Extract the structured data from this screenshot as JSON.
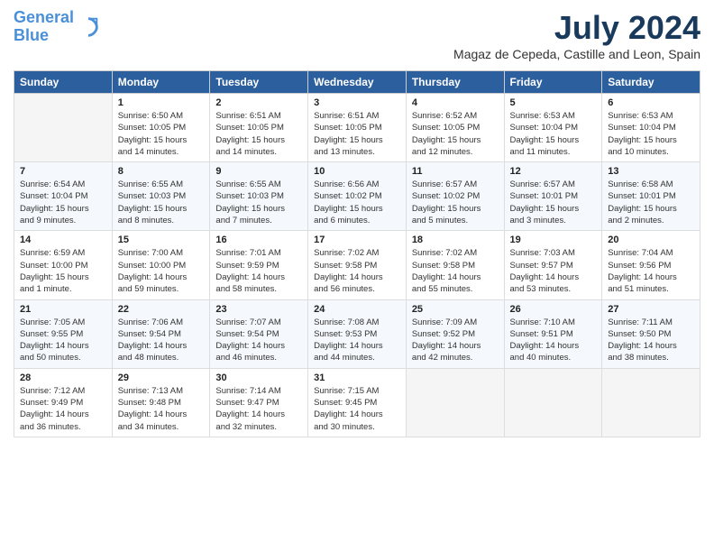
{
  "header": {
    "logo_line1": "General",
    "logo_line2": "Blue",
    "month_title": "July 2024",
    "location": "Magaz de Cepeda, Castille and Leon, Spain"
  },
  "days_of_week": [
    "Sunday",
    "Monday",
    "Tuesday",
    "Wednesday",
    "Thursday",
    "Friday",
    "Saturday"
  ],
  "weeks": [
    [
      {
        "day": "",
        "info": ""
      },
      {
        "day": "1",
        "info": "Sunrise: 6:50 AM\nSunset: 10:05 PM\nDaylight: 15 hours\nand 14 minutes."
      },
      {
        "day": "2",
        "info": "Sunrise: 6:51 AM\nSunset: 10:05 PM\nDaylight: 15 hours\nand 14 minutes."
      },
      {
        "day": "3",
        "info": "Sunrise: 6:51 AM\nSunset: 10:05 PM\nDaylight: 15 hours\nand 13 minutes."
      },
      {
        "day": "4",
        "info": "Sunrise: 6:52 AM\nSunset: 10:05 PM\nDaylight: 15 hours\nand 12 minutes."
      },
      {
        "day": "5",
        "info": "Sunrise: 6:53 AM\nSunset: 10:04 PM\nDaylight: 15 hours\nand 11 minutes."
      },
      {
        "day": "6",
        "info": "Sunrise: 6:53 AM\nSunset: 10:04 PM\nDaylight: 15 hours\nand 10 minutes."
      }
    ],
    [
      {
        "day": "7",
        "info": "Sunrise: 6:54 AM\nSunset: 10:04 PM\nDaylight: 15 hours\nand 9 minutes."
      },
      {
        "day": "8",
        "info": "Sunrise: 6:55 AM\nSunset: 10:03 PM\nDaylight: 15 hours\nand 8 minutes."
      },
      {
        "day": "9",
        "info": "Sunrise: 6:55 AM\nSunset: 10:03 PM\nDaylight: 15 hours\nand 7 minutes."
      },
      {
        "day": "10",
        "info": "Sunrise: 6:56 AM\nSunset: 10:02 PM\nDaylight: 15 hours\nand 6 minutes."
      },
      {
        "day": "11",
        "info": "Sunrise: 6:57 AM\nSunset: 10:02 PM\nDaylight: 15 hours\nand 5 minutes."
      },
      {
        "day": "12",
        "info": "Sunrise: 6:57 AM\nSunset: 10:01 PM\nDaylight: 15 hours\nand 3 minutes."
      },
      {
        "day": "13",
        "info": "Sunrise: 6:58 AM\nSunset: 10:01 PM\nDaylight: 15 hours\nand 2 minutes."
      }
    ],
    [
      {
        "day": "14",
        "info": "Sunrise: 6:59 AM\nSunset: 10:00 PM\nDaylight: 15 hours\nand 1 minute."
      },
      {
        "day": "15",
        "info": "Sunrise: 7:00 AM\nSunset: 10:00 PM\nDaylight: 14 hours\nand 59 minutes."
      },
      {
        "day": "16",
        "info": "Sunrise: 7:01 AM\nSunset: 9:59 PM\nDaylight: 14 hours\nand 58 minutes."
      },
      {
        "day": "17",
        "info": "Sunrise: 7:02 AM\nSunset: 9:58 PM\nDaylight: 14 hours\nand 56 minutes."
      },
      {
        "day": "18",
        "info": "Sunrise: 7:02 AM\nSunset: 9:58 PM\nDaylight: 14 hours\nand 55 minutes."
      },
      {
        "day": "19",
        "info": "Sunrise: 7:03 AM\nSunset: 9:57 PM\nDaylight: 14 hours\nand 53 minutes."
      },
      {
        "day": "20",
        "info": "Sunrise: 7:04 AM\nSunset: 9:56 PM\nDaylight: 14 hours\nand 51 minutes."
      }
    ],
    [
      {
        "day": "21",
        "info": "Sunrise: 7:05 AM\nSunset: 9:55 PM\nDaylight: 14 hours\nand 50 minutes."
      },
      {
        "day": "22",
        "info": "Sunrise: 7:06 AM\nSunset: 9:54 PM\nDaylight: 14 hours\nand 48 minutes."
      },
      {
        "day": "23",
        "info": "Sunrise: 7:07 AM\nSunset: 9:54 PM\nDaylight: 14 hours\nand 46 minutes."
      },
      {
        "day": "24",
        "info": "Sunrise: 7:08 AM\nSunset: 9:53 PM\nDaylight: 14 hours\nand 44 minutes."
      },
      {
        "day": "25",
        "info": "Sunrise: 7:09 AM\nSunset: 9:52 PM\nDaylight: 14 hours\nand 42 minutes."
      },
      {
        "day": "26",
        "info": "Sunrise: 7:10 AM\nSunset: 9:51 PM\nDaylight: 14 hours\nand 40 minutes."
      },
      {
        "day": "27",
        "info": "Sunrise: 7:11 AM\nSunset: 9:50 PM\nDaylight: 14 hours\nand 38 minutes."
      }
    ],
    [
      {
        "day": "28",
        "info": "Sunrise: 7:12 AM\nSunset: 9:49 PM\nDaylight: 14 hours\nand 36 minutes."
      },
      {
        "day": "29",
        "info": "Sunrise: 7:13 AM\nSunset: 9:48 PM\nDaylight: 14 hours\nand 34 minutes."
      },
      {
        "day": "30",
        "info": "Sunrise: 7:14 AM\nSunset: 9:47 PM\nDaylight: 14 hours\nand 32 minutes."
      },
      {
        "day": "31",
        "info": "Sunrise: 7:15 AM\nSunset: 9:45 PM\nDaylight: 14 hours\nand 30 minutes."
      },
      {
        "day": "",
        "info": ""
      },
      {
        "day": "",
        "info": ""
      },
      {
        "day": "",
        "info": ""
      }
    ]
  ]
}
